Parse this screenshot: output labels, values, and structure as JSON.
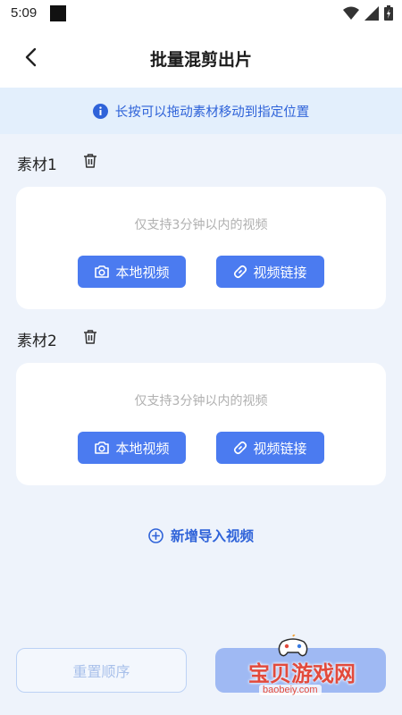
{
  "status_bar": {
    "time": "5:09"
  },
  "header": {
    "title": "批量混剪出片"
  },
  "tip": {
    "text": "长按可以拖动素材移动到指定位置"
  },
  "materials": [
    {
      "label": "素材1",
      "hint": "仅支持3分钟以内的视频",
      "local_label": "本地视频",
      "link_label": "视频链接"
    },
    {
      "label": "素材2",
      "hint": "仅支持3分钟以内的视频",
      "local_label": "本地视频",
      "link_label": "视频链接"
    }
  ],
  "add_video": {
    "label": "新增导入视频"
  },
  "footer": {
    "reset_label": "重置顺序"
  },
  "watermark": {
    "text": "宝贝游戏网",
    "url": "baobeiy.com"
  },
  "colors": {
    "accent": "#4b7bf0",
    "accent_text": "#2f63d9",
    "background": "#eef3fb",
    "tip_background": "#e3effc"
  }
}
